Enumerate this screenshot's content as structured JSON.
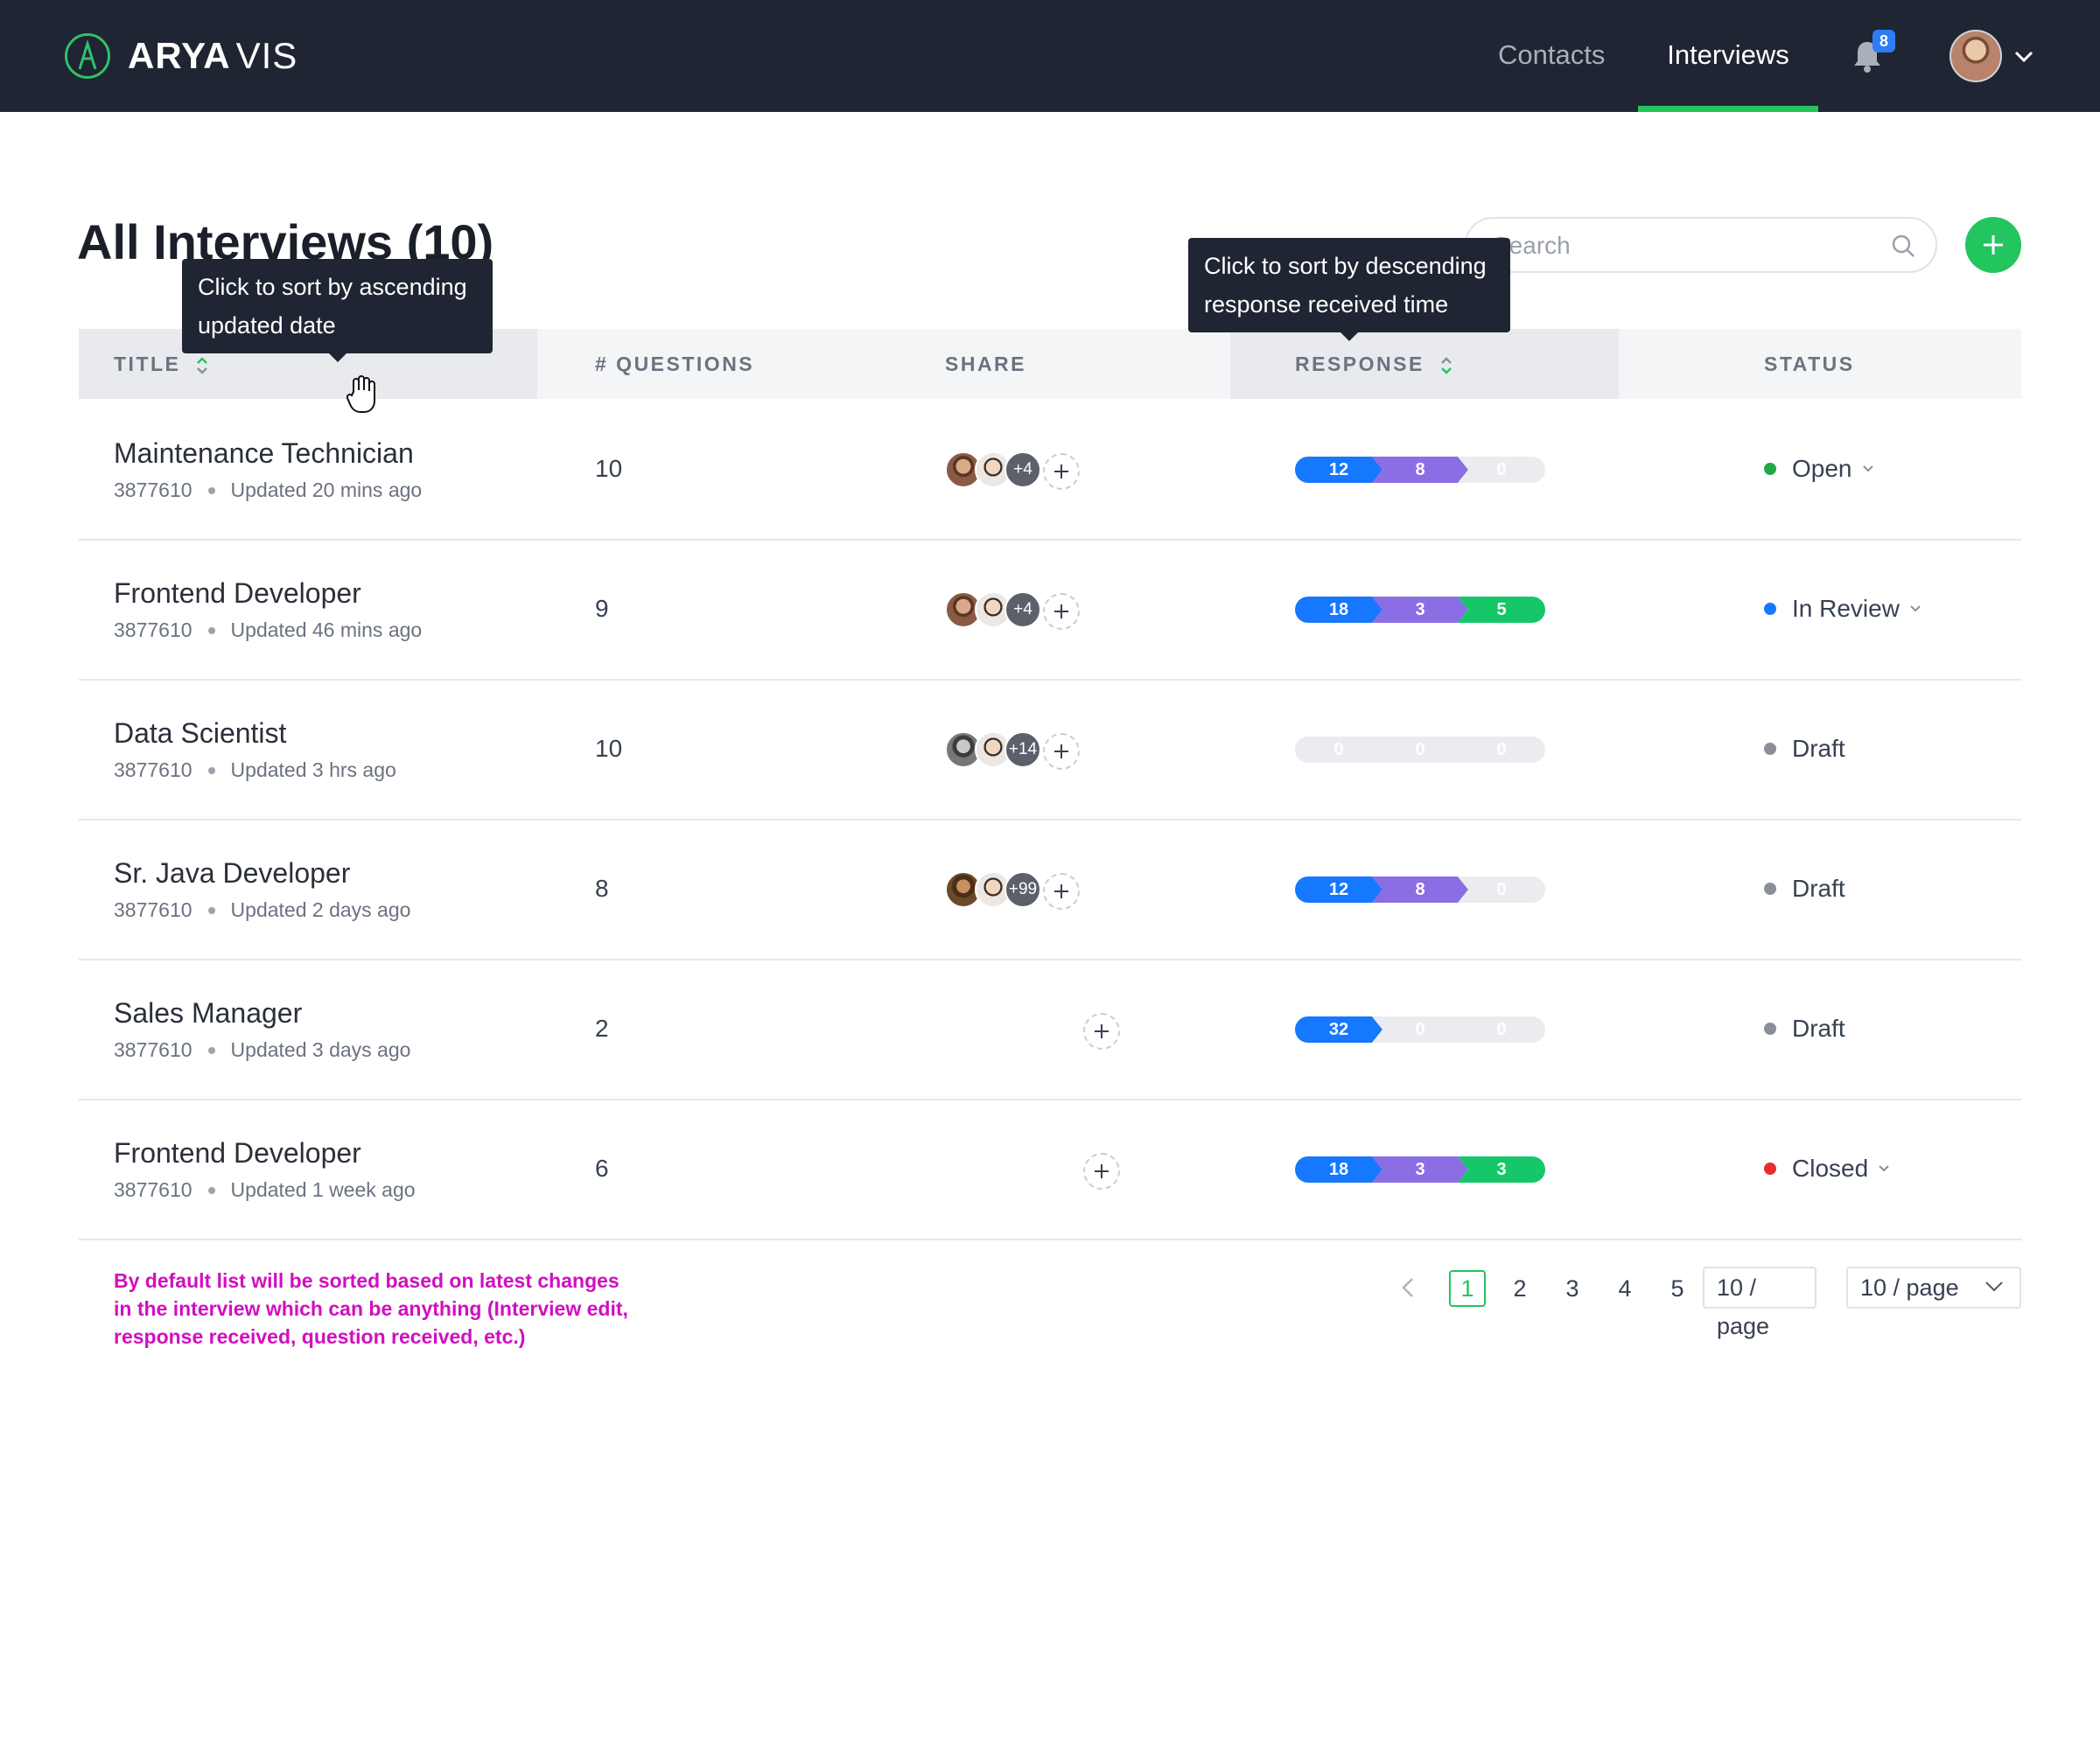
{
  "app": {
    "logo_bold": "ARYA",
    "logo_light": "VIS"
  },
  "nav": {
    "contacts": "Contacts",
    "interviews": "Interviews",
    "notifications_count": "8"
  },
  "page": {
    "title": "All Interviews (10)",
    "search_placeholder": "Search"
  },
  "table": {
    "headers": {
      "title": "TITLE",
      "questions": "# QUESTIONS",
      "share": "SHARE",
      "response": "RESPONSE",
      "status": "STATUS"
    },
    "rows": [
      {
        "title": "Maintenance Technician",
        "id": "3877610",
        "updated": "Updated 20 mins ago",
        "questions": "10",
        "share_more": "+4",
        "responses": [
          "12",
          "8",
          "0"
        ],
        "status": "Open",
        "status_color": "#22a845"
      },
      {
        "title": "Frontend Developer",
        "id": "3877610",
        "updated": "Updated 46 mins ago",
        "questions": "9",
        "share_more": "+4",
        "responses": [
          "18",
          "3",
          "5"
        ],
        "status": "In Review",
        "status_color": "#1677ff"
      },
      {
        "title": "Data Scientist",
        "id": "3877610",
        "updated": "Updated 3 hrs ago",
        "questions": "10",
        "share_more": "+14",
        "responses": [
          "0",
          "0",
          "0"
        ],
        "status": "Draft",
        "status_color": "#8a8f98"
      },
      {
        "title": "Sr. Java Developer",
        "id": "3877610",
        "updated": "Updated 2 days ago",
        "questions": "8",
        "share_more": "+99",
        "responses": [
          "12",
          "8",
          "0"
        ],
        "status": "Draft",
        "status_color": "#8a8f98"
      },
      {
        "title": "Sales Manager",
        "id": "3877610",
        "updated": "Updated 3 days ago",
        "questions": "2",
        "share_more": "",
        "responses": [
          "32",
          "0",
          "0"
        ],
        "status": "Draft",
        "status_color": "#8a8f98"
      },
      {
        "title": "Frontend Developer",
        "id": "3877610",
        "updated": "Updated 1 week ago",
        "questions": "6",
        "share_more": "",
        "responses": [
          "18",
          "3",
          "3"
        ],
        "status": "Closed",
        "status_color": "#e52d2d"
      }
    ]
  },
  "tooltips": {
    "title_sort": "Click to sort by ascending updated date",
    "response_sort": "Click to sort by descending response received time"
  },
  "footer": {
    "note": "By default list will be sorted based on latest changes in the interview which can be anything (Interview edit, response received, question received, etc.)",
    "pages": [
      "1",
      "2",
      "3",
      "4",
      "5"
    ],
    "page_size_1": "10 / page",
    "page_size_2": "10 / page"
  },
  "colors": {
    "accent": "#22c55e",
    "topbar": "#1f2532",
    "note": "#d10fbf"
  }
}
